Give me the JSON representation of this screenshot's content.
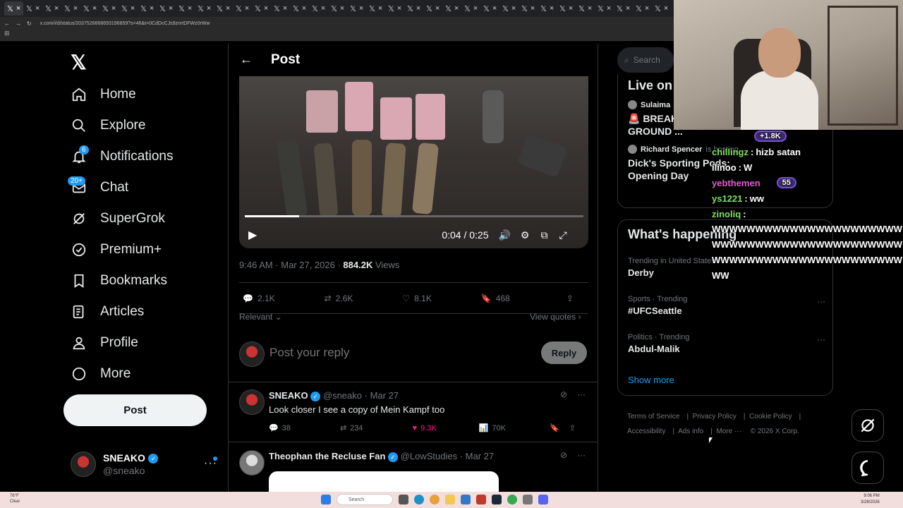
{
  "browser": {
    "tab_glyph": "𝕏",
    "tab_close": "×",
    "tab_count": 35,
    "url": "x.com/i/d/status/2037526668693196859?s=46&t=0CdDcCJs9znrtDFWz0rWw"
  },
  "nav": {
    "logo": "𝕏",
    "items": [
      {
        "label": "Home",
        "icon": "home-icon"
      },
      {
        "label": "Explore",
        "icon": "search-icon"
      },
      {
        "label": "Notifications",
        "icon": "bell-icon",
        "badge": "6"
      },
      {
        "label": "Chat",
        "icon": "mail-icon",
        "badge": "20+"
      },
      {
        "label": "SuperGrok",
        "icon": "grok-icon"
      },
      {
        "label": "Premium+",
        "icon": "verified-icon"
      },
      {
        "label": "Bookmarks",
        "icon": "bookmark-icon"
      },
      {
        "label": "Articles",
        "icon": "articles-icon"
      },
      {
        "label": "Profile",
        "icon": "profile-icon"
      },
      {
        "label": "More",
        "icon": "more-circle-icon"
      }
    ],
    "post_label": "Post",
    "account": {
      "name": "SNEAKO",
      "handle": "@sneako",
      "more": "···"
    }
  },
  "post": {
    "header_title": "Post",
    "video": {
      "time": "0:04 / 0:25",
      "progress": 0.16
    },
    "meta_time": "9:46 AM · Mar 27, 2026 · ",
    "meta_views": "884.2K",
    "meta_views_label": " Views",
    "stats": {
      "replies": "2.1K",
      "reposts": "2.6K",
      "likes": "8.1K",
      "bookmarks": "468"
    },
    "sort_label": "Relevant",
    "view_quotes": "View quotes",
    "reply_placeholder": "Post your reply",
    "reply_button": "Reply"
  },
  "replies": [
    {
      "name": "SNEAKO",
      "handle": "@sneako",
      "date": "· Mar 27",
      "text": "Look closer I see a copy of Mein Kampf too",
      "replies": "38",
      "reposts": "234",
      "likes": "9.3K",
      "views": "70K"
    },
    {
      "name": "Theophan the Recluse Fan",
      "handle": "@LowStudies",
      "date": "· Mar 27"
    }
  ],
  "sidebar": {
    "search_placeholder": "Search",
    "live": {
      "title": "Live on",
      "items": [
        {
          "host": "Sulaima",
          "title": "🚨 BREAKING... 29 - GROUND ..."
        },
        {
          "host": "Richard Spencer",
          "host_suffix": "is hosting",
          "title": "Dick's Sporting Pods: Opening Day"
        }
      ]
    },
    "happening": {
      "title": "What's happening",
      "trends": [
        {
          "context": "Trending in United States",
          "name": "Derby"
        },
        {
          "context": "Sports · Trending",
          "name": "#UFCSeattle"
        },
        {
          "context": "Politics · Trending",
          "name": "Abdul-Malik"
        }
      ],
      "show_more": "Show more"
    },
    "footer": [
      "Terms of Service",
      "Privacy Policy",
      "Cookie Policy",
      "Accessibility",
      "Ads info",
      "More ···",
      "© 2026 X Corp."
    ]
  },
  "stream_chat": {
    "viewer_pill": "+1.8K",
    "messages": [
      {
        "user": "chillingz",
        "text": "hizb satan"
      },
      {
        "user": "ilinoo",
        "text": "W"
      },
      {
        "user": "yebthemen",
        "text": "",
        "pill": "55"
      },
      {
        "user": "ys1221",
        "text": "ww"
      },
      {
        "user": "zinoliq",
        "text": ""
      }
    ],
    "spam": "WWWWWWWWWWWWWWWWWWWWWWWWWWWWWWWWWWWWWWWWWWWWWWWWWWWWWWWWWWWWWWWWWWWW"
  },
  "taskbar": {
    "weather_temp": "76°F",
    "weather_desc": "Clear",
    "search": "Search",
    "time": "9:06 PM",
    "date": "3/28/2026"
  },
  "colors": {
    "accent": "#1d9bf0",
    "like": "#f91880",
    "bg": "#000000",
    "taskbar": "#f3dede"
  }
}
